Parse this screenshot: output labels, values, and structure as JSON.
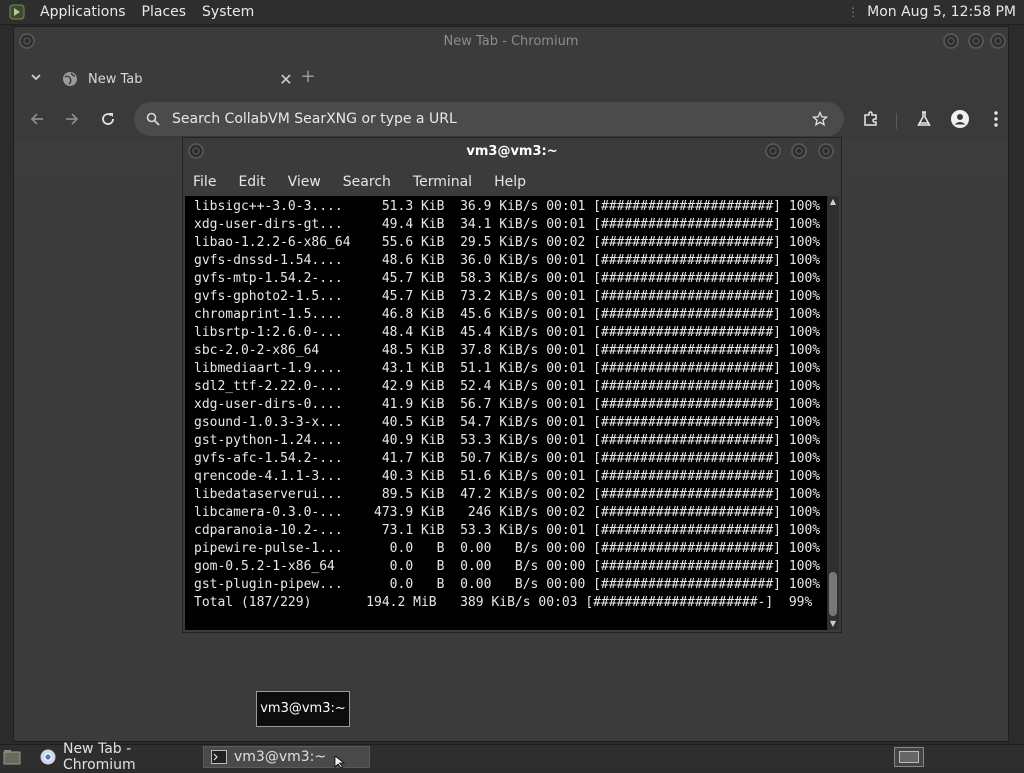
{
  "top_panel": {
    "menus": [
      "Applications",
      "Places",
      "System"
    ],
    "clock": "Mon Aug  5, 12:58 PM"
  },
  "chromium": {
    "window_title": "New Tab - Chromium",
    "tab_label": "New Tab",
    "omnibox_placeholder": "Search CollabVM SearXNG or type a URL"
  },
  "terminal": {
    "window_title": "vm3@vm3:~",
    "menus": [
      "File",
      "Edit",
      "View",
      "Search",
      "Terminal",
      "Help"
    ],
    "lines": [
      "libsigc++-3.0-3....     51.3 KiB  36.9 KiB/s 00:01 [######################] 100%",
      "xdg-user-dirs-gt...     49.4 KiB  34.1 KiB/s 00:01 [######################] 100%",
      "libao-1.2.2-6-x86_64    55.6 KiB  29.5 KiB/s 00:02 [######################] 100%",
      "gvfs-dnssd-1.54....     48.6 KiB  36.0 KiB/s 00:01 [######################] 100%",
      "gvfs-mtp-1.54.2-...     45.7 KiB  58.3 KiB/s 00:01 [######################] 100%",
      "gvfs-gphoto2-1.5...     45.7 KiB  73.2 KiB/s 00:01 [######################] 100%",
      "chromaprint-1.5....     46.8 KiB  45.6 KiB/s 00:01 [######################] 100%",
      "libsrtp-1:2.6.0-...     48.4 KiB  45.4 KiB/s 00:01 [######################] 100%",
      "sbc-2.0-2-x86_64        48.5 KiB  37.8 KiB/s 00:01 [######################] 100%",
      "libmediaart-1.9....     43.1 KiB  51.1 KiB/s 00:01 [######################] 100%",
      "sdl2_ttf-2.22.0-...     42.9 KiB  52.4 KiB/s 00:01 [######################] 100%",
      "xdg-user-dirs-0....     41.9 KiB  56.7 KiB/s 00:01 [######################] 100%",
      "gsound-1.0.3-3-x...     40.5 KiB  54.7 KiB/s 00:01 [######################] 100%",
      "gst-python-1.24....     40.9 KiB  53.3 KiB/s 00:01 [######################] 100%",
      "gvfs-afc-1.54.2-...     41.7 KiB  50.7 KiB/s 00:01 [######################] 100%",
      "qrencode-4.1.1-3...     40.3 KiB  51.6 KiB/s 00:01 [######################] 100%",
      "libedataserverui...     89.5 KiB  47.2 KiB/s 00:02 [######################] 100%",
      "libcamera-0.3.0-...    473.9 KiB   246 KiB/s 00:02 [######################] 100%",
      "cdparanoia-10.2-...     73.1 KiB  53.3 KiB/s 00:01 [######################] 100%",
      "pipewire-pulse-1...      0.0   B  0.00   B/s 00:00 [######################] 100%",
      "gom-0.5.2-1-x86_64       0.0   B  0.00   B/s 00:00 [######################] 100%",
      "gst-plugin-pipew...      0.0   B  0.00   B/s 00:00 [######################] 100%",
      "Total (187/229)       194.2 MiB   389 KiB/s 00:03 [#####################-]  99%"
    ]
  },
  "tooltip": {
    "text": "vm3@vm3:~"
  },
  "taskbar": {
    "tasks": [
      "New Tab - Chromium",
      "vm3@vm3:~"
    ]
  },
  "colors": {
    "panel_bg": "#2e2e2e",
    "window_bg": "#3b3b3b",
    "terminal_bg": "#000000"
  }
}
